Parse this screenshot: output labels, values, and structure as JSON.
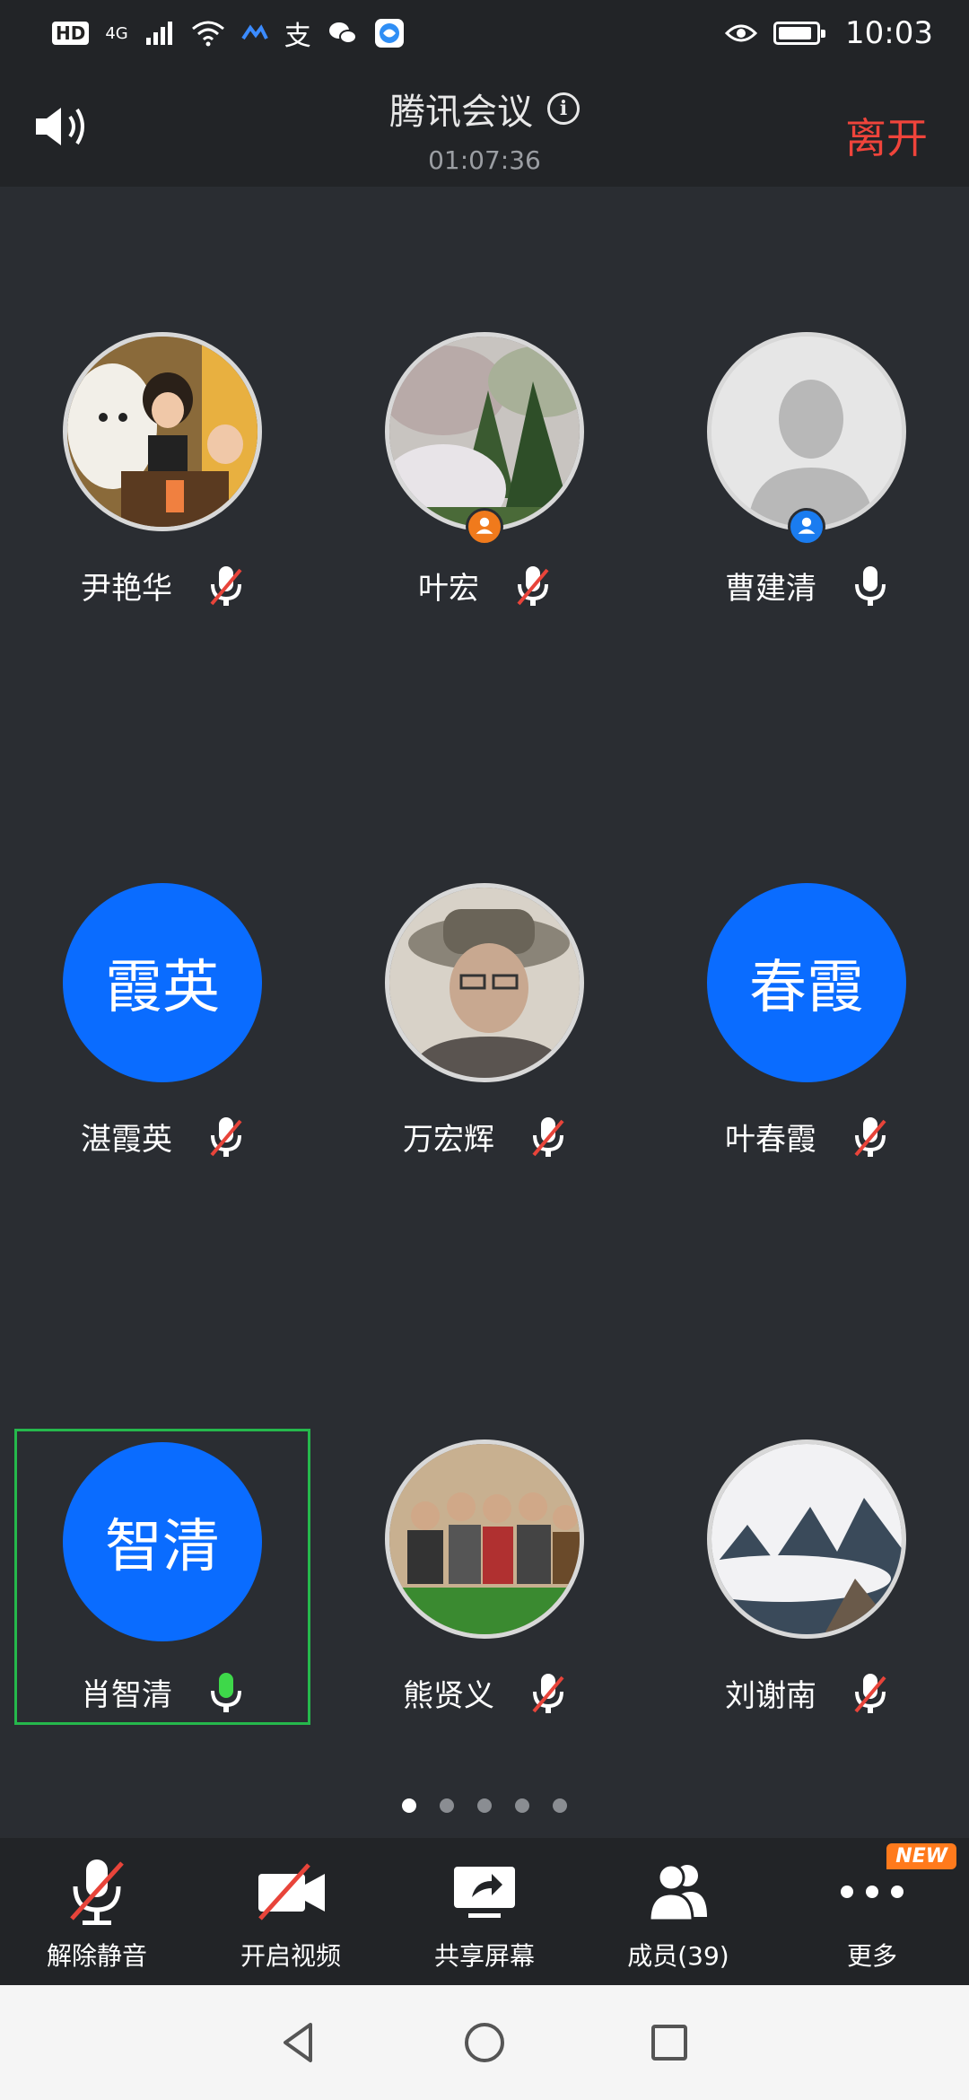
{
  "status_bar": {
    "network_badge": "HD",
    "network_type": "4G",
    "app_icons": [
      "cloud-app-icon",
      "alipay-icon",
      "wechat-icon",
      "browser-app-icon"
    ],
    "time": "10:03"
  },
  "header": {
    "title": "腾讯会议",
    "duration": "01:07:36",
    "leave_label": "离开"
  },
  "participants": [
    {
      "name": "尹艳华",
      "avatar": "photo-children-dog",
      "mic": "muted"
    },
    {
      "name": "叶宏",
      "avatar": "photo-blossom-trees",
      "mic": "muted",
      "badge": "host"
    },
    {
      "name": "曹建清",
      "avatar": "default-silhouette",
      "mic": "on",
      "badge": "cohost"
    },
    {
      "name": "湛霞英",
      "avatar_text": "霞英",
      "mic": "muted"
    },
    {
      "name": "万宏辉",
      "avatar": "photo-man-hat",
      "mic": "muted"
    },
    {
      "name": "叶春霞",
      "avatar_text": "春霞",
      "mic": "muted"
    },
    {
      "name": "肖智清",
      "avatar_text": "智清",
      "mic": "speaking",
      "active": true
    },
    {
      "name": "熊贤义",
      "avatar": "photo-group-dinner",
      "mic": "muted"
    },
    {
      "name": "刘谢南",
      "avatar": "photo-mountain-mist",
      "mic": "muted"
    }
  ],
  "pagination": {
    "pages": 5,
    "current": 1
  },
  "toolbar": {
    "unmute": "解除静音",
    "start_video": "开启视频",
    "share_screen": "共享屏幕",
    "members": "成员(39)",
    "more": "更多",
    "new_badge": "NEW"
  },
  "colors": {
    "accent_blue": "#0a6cff",
    "leave_red": "#f0443b",
    "active_green": "#25b84c",
    "host_orange": "#f07a1c",
    "background": "#2a2d32"
  }
}
